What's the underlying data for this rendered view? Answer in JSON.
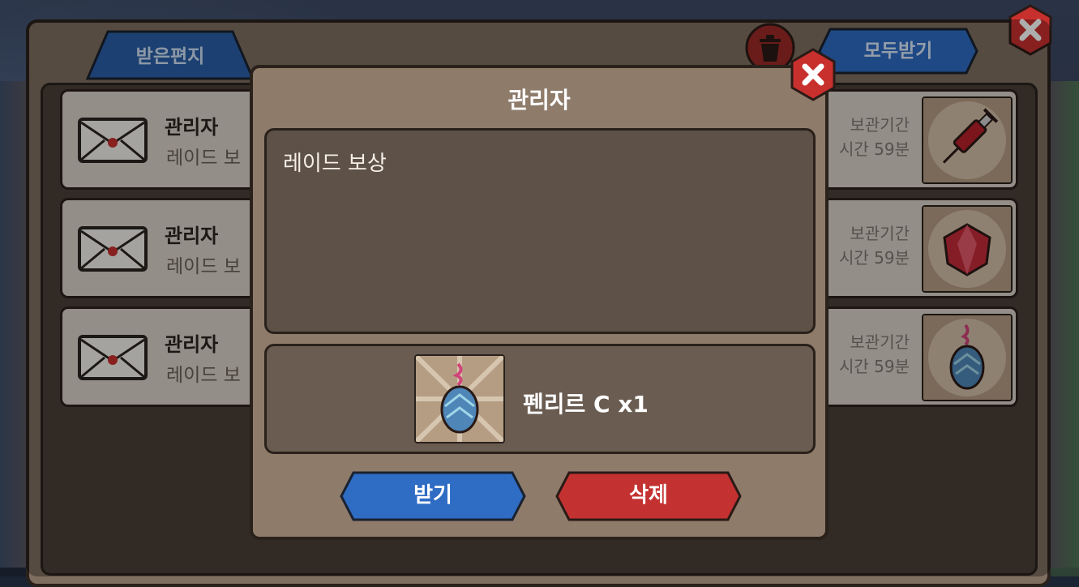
{
  "window": {
    "tab_inbox": "받은편지",
    "receive_all_label": "모두받기"
  },
  "mail_list": [
    {
      "sender": "관리자",
      "subject": "레이드 보",
      "expire_line1": "보관기간",
      "expire_line2": "시간 59분",
      "item_icon": "syringe-icon"
    },
    {
      "sender": "관리자",
      "subject": "레이드 보",
      "expire_line1": "보관기간",
      "expire_line2": "시간 59분",
      "item_icon": "red-gem-icon"
    },
    {
      "sender": "관리자",
      "subject": "레이드 보",
      "expire_line1": "보관기간",
      "expire_line2": "시간 59분",
      "item_icon": "egg-icon"
    }
  ],
  "modal": {
    "title": "관리자",
    "message": "레이드 보상",
    "reward_label": "펜리르 C x1",
    "reward_icon": "egg-icon",
    "claim_label": "받기",
    "delete_label": "삭제"
  },
  "colors": {
    "panel": "#7f6f60",
    "modal": "#8e7b6a",
    "blue_button": "#2f6cc4",
    "red_button": "#c43131",
    "close_button": "#c8302e"
  }
}
